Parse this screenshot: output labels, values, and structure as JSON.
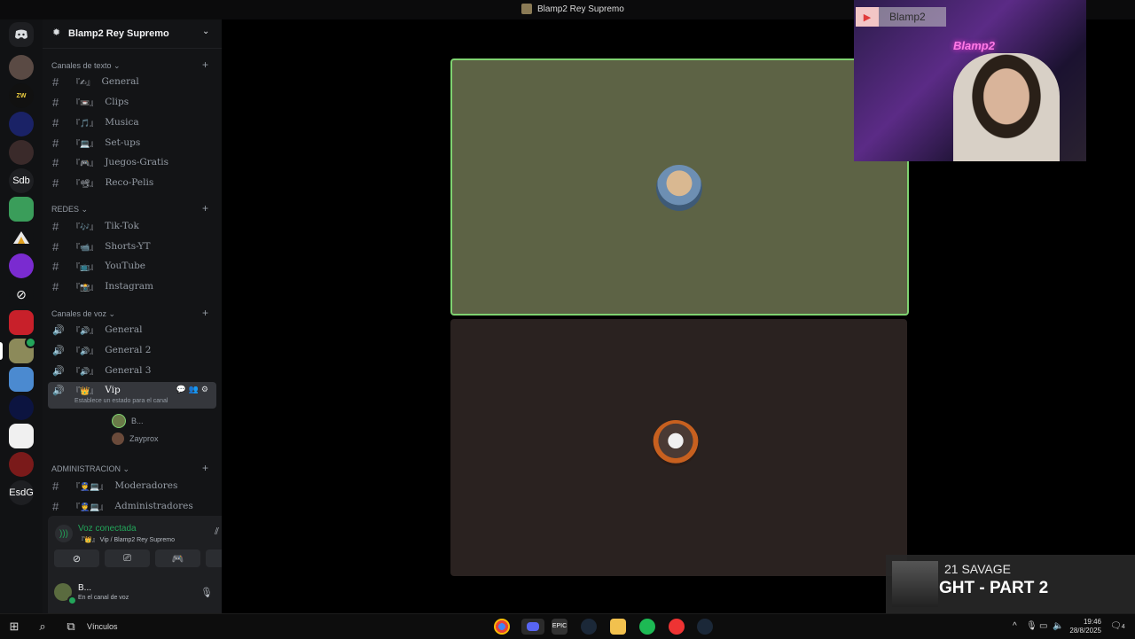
{
  "window": {
    "title": "Blamp2 Rey Supremo"
  },
  "server": {
    "name": "Blamp2 Rey Supremo"
  },
  "guilds": [
    "Sdb",
    "EsdG"
  ],
  "categories": {
    "text": "Canales de texto",
    "redes": "REDES",
    "voice": "Canales de voz",
    "admin": "ADMINISTRACION"
  },
  "text_channels": [
    {
      "emoji": "『✍』",
      "name": "General"
    },
    {
      "emoji": "『📼』",
      "name": "Clips"
    },
    {
      "emoji": "『🎵』",
      "name": "Musica"
    },
    {
      "emoji": "『💻』",
      "name": "Set-ups"
    },
    {
      "emoji": "『🎮』",
      "name": "Juegos-Gratis"
    },
    {
      "emoji": "『📽』",
      "name": "Reco-Pelis"
    }
  ],
  "redes_channels": [
    {
      "emoji": "『🎶』",
      "name": "Tik-Tok"
    },
    {
      "emoji": "『📹』",
      "name": "Shorts-YT"
    },
    {
      "emoji": "『📺』",
      "name": "YouTube"
    },
    {
      "emoji": "『📸』",
      "name": "Instagram"
    }
  ],
  "voice_channels": [
    {
      "emoji": "『🔊』",
      "name": "General"
    },
    {
      "emoji": "『🔊』",
      "name": "General 2"
    },
    {
      "emoji": "『🔊』",
      "name": "General 3"
    },
    {
      "emoji": "『👑』",
      "name": "Vip",
      "hint": "Establece un estado para el canal"
    }
  ],
  "voice_users": [
    {
      "name": "B..."
    },
    {
      "name": "Zayprox"
    }
  ],
  "admin_channels": [
    {
      "emoji": "『👮💻』",
      "name": "Moderadores"
    },
    {
      "emoji": "『👮💻』",
      "name": "Administradores"
    }
  ],
  "voice_panel": {
    "status": "Voz conectada",
    "location": "『👑』 Vip / Blamp2 Rey Supremo",
    "user_name": "B...",
    "user_status": "En el canal de voz"
  },
  "webcam": {
    "channel_name": "Blamp2",
    "neon_sign": "Blamp2"
  },
  "now_playing": {
    "artist": "21 SAVAGE",
    "track": "GHT - PART 2"
  },
  "taskbar": {
    "search_label": "Vínculos",
    "time": "19:46",
    "date": "28/8/2025",
    "notifications": "4"
  },
  "icons": {
    "discord": "discord-icon",
    "gear": "gear-icon",
    "hash": "hash-icon",
    "speaker": "speaker-icon",
    "mic": "mic-icon",
    "headphones": "headphones-icon",
    "hangup": "hangup-icon"
  },
  "colors": {
    "speaking_border": "#7fd371",
    "connected": "#23a55a",
    "blurple": "#5865f2"
  }
}
